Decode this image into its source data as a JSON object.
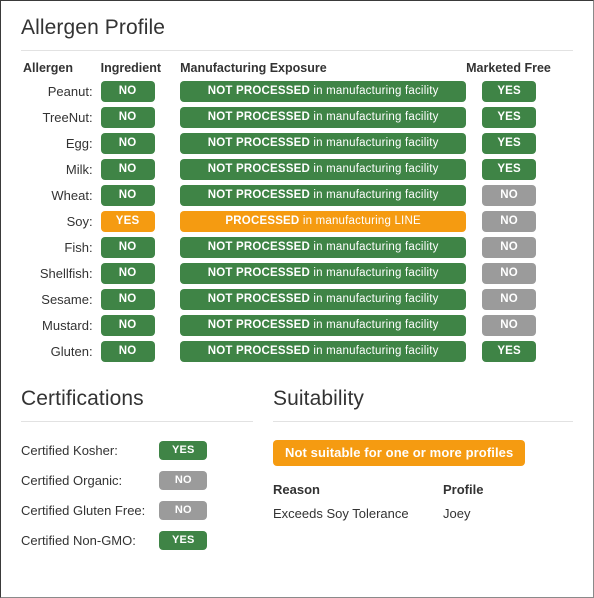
{
  "allergen_profile": {
    "title": "Allergen Profile",
    "headers": {
      "allergen": "Allergen",
      "ingredient": "Ingredient",
      "exposure": "Manufacturing Exposure",
      "marketed_free": "Marketed Free"
    },
    "rows": [
      {
        "label": "Peanut:",
        "ingredient": "NO",
        "ingredient_state": "green",
        "exposure_strong": "NOT PROCESSED",
        "exposure_rest": " in manufacturing facility",
        "exposure_state": "green",
        "marketed": "YES",
        "marketed_state": "green"
      },
      {
        "label": "TreeNut:",
        "ingredient": "NO",
        "ingredient_state": "green",
        "exposure_strong": "NOT PROCESSED",
        "exposure_rest": " in manufacturing facility",
        "exposure_state": "green",
        "marketed": "YES",
        "marketed_state": "green"
      },
      {
        "label": "Egg:",
        "ingredient": "NO",
        "ingredient_state": "green",
        "exposure_strong": "NOT PROCESSED",
        "exposure_rest": " in manufacturing facility",
        "exposure_state": "green",
        "marketed": "YES",
        "marketed_state": "green"
      },
      {
        "label": "Milk:",
        "ingredient": "NO",
        "ingredient_state": "green",
        "exposure_strong": "NOT PROCESSED",
        "exposure_rest": " in manufacturing facility",
        "exposure_state": "green",
        "marketed": "YES",
        "marketed_state": "green"
      },
      {
        "label": "Wheat:",
        "ingredient": "NO",
        "ingredient_state": "green",
        "exposure_strong": "NOT PROCESSED",
        "exposure_rest": " in manufacturing facility",
        "exposure_state": "green",
        "marketed": "NO",
        "marketed_state": "gray"
      },
      {
        "label": "Soy:",
        "ingredient": "YES",
        "ingredient_state": "orange",
        "exposure_strong": "PROCESSED",
        "exposure_rest": " in manufacturing LINE",
        "exposure_state": "orange",
        "marketed": "NO",
        "marketed_state": "gray"
      },
      {
        "label": "Fish:",
        "ingredient": "NO",
        "ingredient_state": "green",
        "exposure_strong": "NOT PROCESSED",
        "exposure_rest": " in manufacturing facility",
        "exposure_state": "green",
        "marketed": "NO",
        "marketed_state": "gray"
      },
      {
        "label": "Shellfish:",
        "ingredient": "NO",
        "ingredient_state": "green",
        "exposure_strong": "NOT PROCESSED",
        "exposure_rest": " in manufacturing facility",
        "exposure_state": "green",
        "marketed": "NO",
        "marketed_state": "gray"
      },
      {
        "label": "Sesame:",
        "ingredient": "NO",
        "ingredient_state": "green",
        "exposure_strong": "NOT PROCESSED",
        "exposure_rest": " in manufacturing facility",
        "exposure_state": "green",
        "marketed": "NO",
        "marketed_state": "gray"
      },
      {
        "label": "Mustard:",
        "ingredient": "NO",
        "ingredient_state": "green",
        "exposure_strong": "NOT PROCESSED",
        "exposure_rest": " in manufacturing facility",
        "exposure_state": "green",
        "marketed": "NO",
        "marketed_state": "gray"
      },
      {
        "label": "Gluten:",
        "ingredient": "NO",
        "ingredient_state": "green",
        "exposure_strong": "NOT PROCESSED",
        "exposure_rest": " in manufacturing facility",
        "exposure_state": "green",
        "marketed": "YES",
        "marketed_state": "green"
      }
    ]
  },
  "certifications": {
    "title": "Certifications",
    "rows": [
      {
        "label": "Certified Kosher:",
        "value": "YES",
        "state": "green"
      },
      {
        "label": "Certified Organic:",
        "value": "NO",
        "state": "gray"
      },
      {
        "label": "Certified Gluten Free:",
        "value": "NO",
        "state": "gray"
      },
      {
        "label": "Certified Non-GMO:",
        "value": "YES",
        "state": "green"
      }
    ]
  },
  "suitability": {
    "title": "Suitability",
    "banner": "Not suitable for one or more profiles",
    "headers": {
      "reason": "Reason",
      "profile": "Profile"
    },
    "rows": [
      {
        "reason": "Exceeds Soy Tolerance",
        "profile": "Joey"
      }
    ]
  },
  "colors": {
    "green": "#3f8446",
    "orange": "#f59b11",
    "gray": "#9b9b9b",
    "text": "#333333",
    "divider": "#e2e2e2",
    "border": "#3a3a3a"
  }
}
